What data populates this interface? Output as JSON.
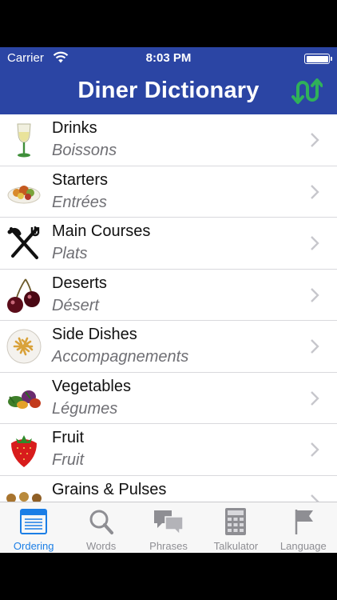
{
  "status_bar": {
    "carrier": "Carrier",
    "time": "8:03 PM",
    "battery_level": 1.0
  },
  "nav": {
    "title": "Diner Dictionary",
    "swap_icon": "swap-arrows-icon"
  },
  "list": [
    {
      "en": "Drinks",
      "fr": "Boissons",
      "icon": "wine-glass-icon"
    },
    {
      "en": "Starters",
      "fr": "Entrées",
      "icon": "salad-bowl-icon"
    },
    {
      "en": "Main Courses",
      "fr": "Plats",
      "icon": "fork-knife-icon"
    },
    {
      "en": "Deserts",
      "fr": "Désert",
      "icon": "cherries-icon"
    },
    {
      "en": "Side Dishes",
      "fr": "Accompagnements",
      "icon": "fries-plate-icon"
    },
    {
      "en": "Vegetables",
      "fr": "Légumes",
      "icon": "vegetables-icon"
    },
    {
      "en": "Fruit",
      "fr": "Fruit",
      "icon": "strawberry-icon"
    },
    {
      "en": "Grains & Pulses",
      "fr": "",
      "icon": "grains-icon"
    }
  ],
  "tabs": [
    {
      "label": "Ordering",
      "icon": "ordering-icon",
      "active": true
    },
    {
      "label": "Words",
      "icon": "magnifier-icon",
      "active": false
    },
    {
      "label": "Phrases",
      "icon": "speech-bubbles-icon",
      "active": false
    },
    {
      "label": "Talkulator",
      "icon": "calculator-icon",
      "active": false
    },
    {
      "label": "Language",
      "icon": "flag-icon",
      "active": false
    }
  ],
  "colors": {
    "nav_bg": "#2b45a4",
    "accent": "#1b7ee6",
    "swap_icon": "#2fb15a"
  }
}
